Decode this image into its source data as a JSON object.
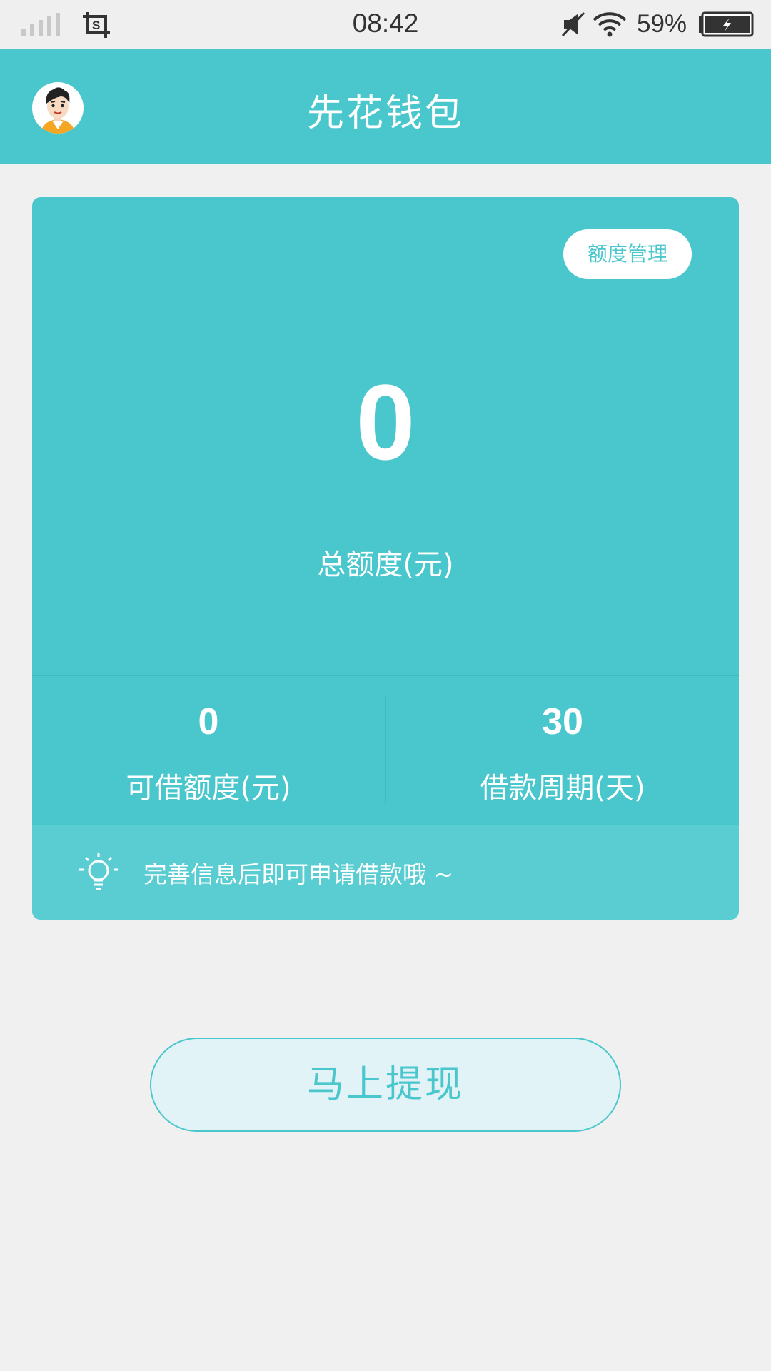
{
  "status_bar": {
    "time": "08:42",
    "battery_percent": "59%",
    "icons": [
      "signal-icon",
      "screenshot-icon",
      "mute-icon",
      "wifi-icon",
      "battery-charging-icon"
    ]
  },
  "header": {
    "title": "先花钱包",
    "avatar_icon": "user-avatar"
  },
  "credit_card": {
    "manage_button_label": "额度管理",
    "total_value": "0",
    "total_label": "总额度(元)",
    "stats": [
      {
        "value": "0",
        "label": "可借额度(元)"
      },
      {
        "value": "30",
        "label": "借款周期(天)"
      }
    ],
    "tip_icon": "lightbulb-icon",
    "tip_text": "完善信息后即可申请借款哦 ~"
  },
  "withdraw_button_label": "马上提现",
  "colors": {
    "accent": "#4ac6cd",
    "tip_background": "#5acdd3",
    "page_background": "#f0f0f0",
    "button_background": "#e1f3f6"
  }
}
